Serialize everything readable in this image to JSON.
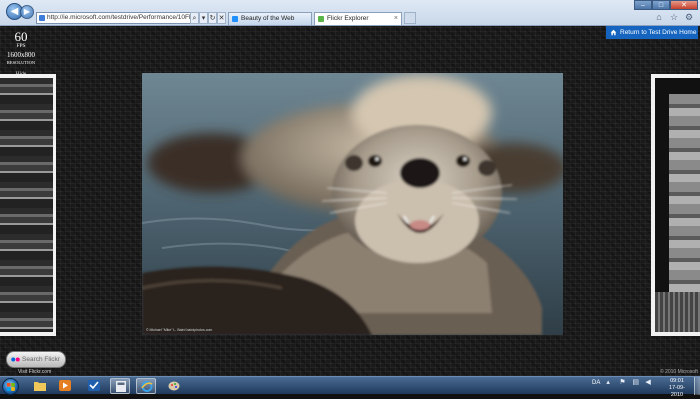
{
  "browser": {
    "address": "http://ie.microsoft.com/testdrive/Performance/10FlickrExpl",
    "tabs": [
      {
        "label": "Beauty of the Web"
      },
      {
        "label": "Flickr Explorer"
      }
    ],
    "tab_close": "×",
    "window_buttons": {
      "minimize": "–",
      "maximize": "□",
      "close": "✕"
    },
    "toolbar_icons": [
      "home-icon",
      "favorites-icon",
      "tools-icon"
    ]
  },
  "stats": {
    "fps_value": "60",
    "fps_label": "FPS",
    "resolution_value": "1600x800",
    "resolution_label": "RESOLUTION",
    "hide_label": "Hide"
  },
  "return_button": {
    "label": "Return to Test Drive Home"
  },
  "photo": {
    "credit": "© Michael \"Mike\" L. Baird  bairdphotos.com"
  },
  "search": {
    "placeholder": "Search Flickr",
    "visit_link": "Visit Flickr.com"
  },
  "copyright": "© 2010 Microsoft",
  "taskbar": {
    "apps": [
      "explorer",
      "media-player",
      "outlook",
      "calculator",
      "internet-explorer",
      "paint"
    ],
    "language": "DA",
    "clock_time": "09:01",
    "clock_date": "17-09-2010"
  },
  "colors": {
    "accent_blue": "#1565c0",
    "page_background": "#1a1a1a",
    "taskbar": "#1f3a5c"
  }
}
